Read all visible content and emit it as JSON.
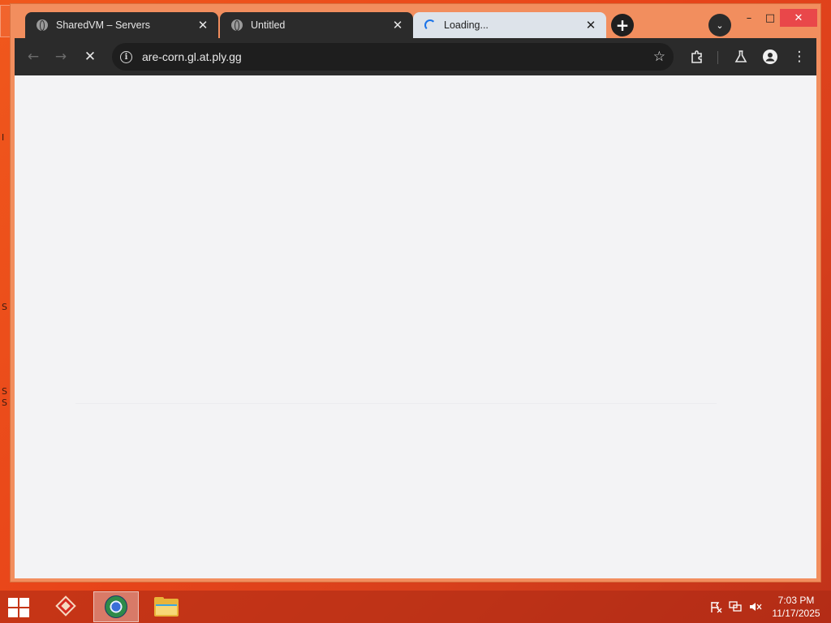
{
  "browser": {
    "tabs": [
      {
        "title": "SharedVM – Servers",
        "favicon": "globe-icon",
        "active": false
      },
      {
        "title": "Untitled",
        "favicon": "globe-icon",
        "active": false
      },
      {
        "title": "Loading...",
        "favicon": "loading-spinner-icon",
        "active": true
      }
    ],
    "tab_close_glyph": "✕",
    "new_tab_glyph": "+",
    "tab_search_glyph": "⌄",
    "window_controls": {
      "minimize": "–",
      "maximize": "□",
      "close": "✕"
    },
    "toolbar": {
      "back_glyph": "←",
      "forward_glyph": "→",
      "stop_glyph": "✕",
      "url": "are-corn.gl.at.ply.gg",
      "info_glyph": "i",
      "bookmark_glyph": "☆",
      "extensions_icon": "puzzle-icon",
      "labs_icon": "flask-icon",
      "profile_icon": "person-icon",
      "menu_glyph": "⋮"
    }
  },
  "taskbar": {
    "apps": [
      {
        "name": "app-icon",
        "active": false
      },
      {
        "name": "browser-icon",
        "active": true
      },
      {
        "name": "file-explorer-icon",
        "active": false
      }
    ],
    "clock": {
      "time": "7:03 PM",
      "date": "11/17/2025"
    }
  },
  "desktop": {
    "edge_glyphs": [
      "I",
      "S",
      "S",
      "S"
    ]
  }
}
